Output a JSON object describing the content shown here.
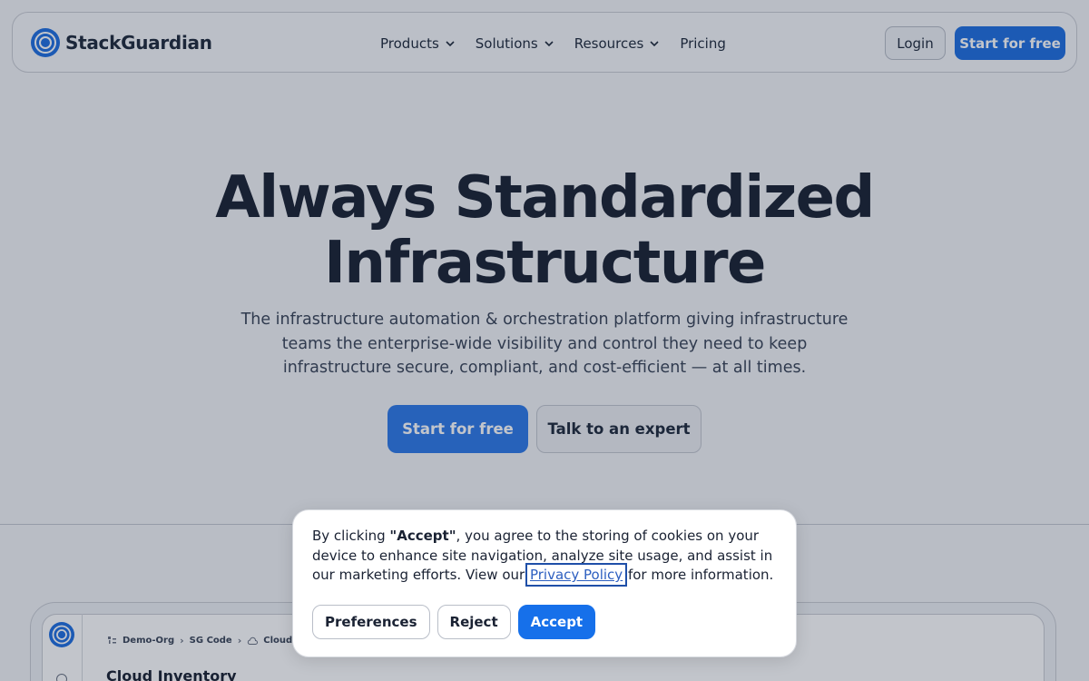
{
  "header": {
    "brand": "StackGuardian",
    "nav": [
      {
        "label": "Products",
        "has_dropdown": true
      },
      {
        "label": "Solutions",
        "has_dropdown": true
      },
      {
        "label": "Resources",
        "has_dropdown": true
      },
      {
        "label": "Pricing",
        "has_dropdown": false
      }
    ],
    "login_label": "Login",
    "start_label": "Start for free"
  },
  "hero": {
    "title_line1": "Always Standardized",
    "title_line2": "Infrastructure",
    "subtitle": "The infrastructure automation & orchestration platform giving infrastructure teams the enterprise-wide visibility and control they need to keep infrastructure secure, compliant, and cost-efficient — at all times.",
    "primary_cta": "Start for free",
    "secondary_cta": "Talk to an expert"
  },
  "preview": {
    "breadcrumbs": [
      "Demo-Org",
      "SG Code",
      "Cloud Inv"
    ],
    "title": "Cloud Inventory"
  },
  "cookie": {
    "text_prefix": "By clicking ",
    "accept_quoted": "\"Accept\"",
    "text_middle": ", you agree to the storing of cookies on your device to enhance site navigation, analyze site usage, and assist in our marketing efforts. View our ",
    "link_label": "Privacy Policy",
    "text_suffix": " for more information.",
    "preferences_label": "Preferences",
    "reject_label": "Reject",
    "accept_label": "Accept"
  },
  "colors": {
    "accent": "#1f6fe0",
    "accept_button": "#1670ea",
    "heading": "#1a2233",
    "overlay": "rgba(20,30,55,0.26)"
  },
  "icons": [
    "stackguardian-logo-icon",
    "chevron-down-icon",
    "breadcrumb-chevron-icon",
    "org-icon",
    "cloud-icon"
  ]
}
